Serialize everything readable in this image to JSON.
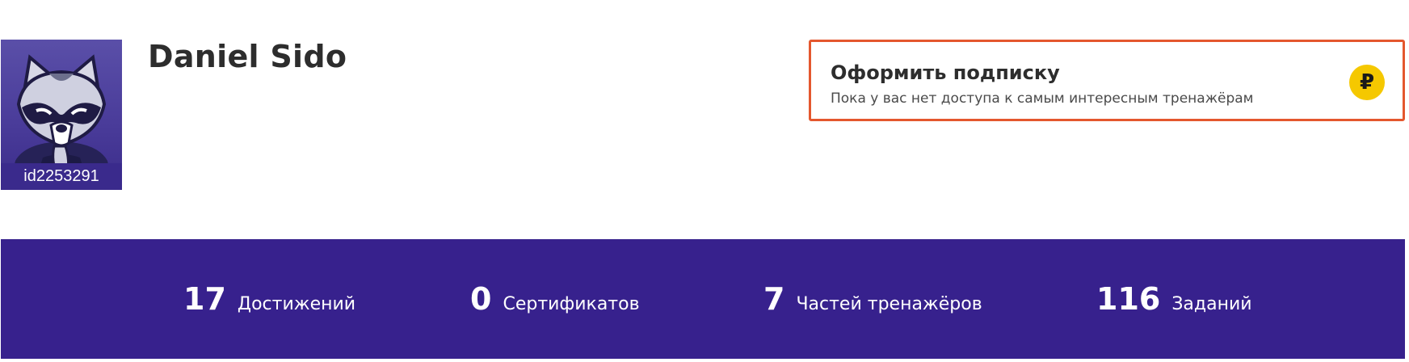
{
  "profile": {
    "name": "Daniel Sido",
    "id_label": "id2253291",
    "avatar_icon": "raccoon-avatar"
  },
  "subscription": {
    "title": "Оформить подписку",
    "description": "Пока у вас нет доступа к самым интересным тренажёрам",
    "badge_symbol": "₽",
    "badge_icon": "ruble-icon",
    "border_color": "#e4572e",
    "badge_color": "#f5c800"
  },
  "stats": [
    {
      "value": "17",
      "label": "Достижений"
    },
    {
      "value": "0",
      "label": "Сертификатов"
    },
    {
      "value": "7",
      "label": "Частей тренажёров"
    },
    {
      "value": "116",
      "label": "Заданий"
    }
  ],
  "colors": {
    "stats_background": "#37218d",
    "avatar_background": "#4a3c9a"
  }
}
